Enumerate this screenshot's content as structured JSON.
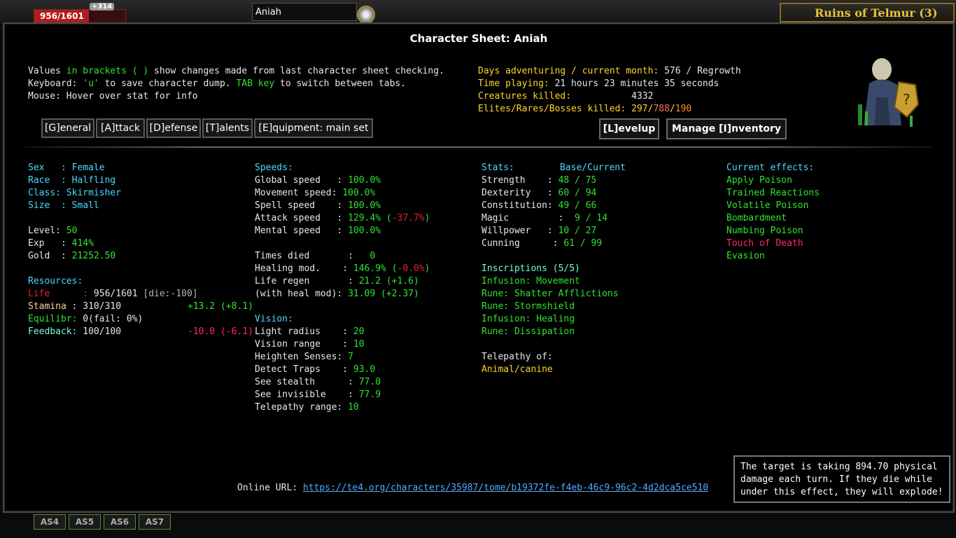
{
  "hud": {
    "life": "956/1601",
    "life_fraction": 0.597,
    "regen": "+314",
    "player_name": "Aniah",
    "zone": "Ruins of Telmur (3)",
    "hotkeys": [
      "AS4",
      "AS5",
      "AS6",
      "AS7"
    ]
  },
  "sheet": {
    "title": "Character Sheet: Aniah",
    "help": {
      "l1_a": "Values ",
      "l1_b": "in brackets ( )",
      "l1_c": " show changes made from last character sheet checking.",
      "l2_a": "Keyboard: ",
      "l2_b": "'u'",
      "l2_c": " to save character dump. ",
      "l2_d": "TAB key",
      "l2_e": " to switch between tabs.",
      "l3": "Mouse: Hover over stat for info"
    },
    "summary": {
      "days_label": "Days adventuring / current month:",
      "days_value": " 576 / Regrowth",
      "time_label": "Time playing:",
      "time_value": " 21 hours 23 minutes 35 seconds",
      "kills_label": "Creatures killed:",
      "kills_value": "           4332",
      "elite_label": "Elites/Rares/Bosses killed:",
      "elite_a": " 297/",
      "elite_b": "788",
      "elite_c": "/",
      "elite_d": "190"
    },
    "tabs": [
      "[G]eneral",
      "[A]ttack",
      "[D]efense",
      "[T]alents",
      "[E]quipment: main set"
    ],
    "levelup": "[L]evelup",
    "inventory": "Manage [I]nventory",
    "general": {
      "sex_label": "Sex   : ",
      "sex": "Female",
      "race_label": "Race  : ",
      "race": "Halfling",
      "class_label": "Class: ",
      "class": "Skirmisher",
      "size_label": "Size  : ",
      "size": "Small",
      "level_label": "Level: ",
      "level": "50",
      "exp_label": "Exp   : ",
      "exp": "414%",
      "gold_label": "Gold  : ",
      "gold": "21252.50"
    },
    "resources": {
      "title": "Resources:",
      "life_label": "Life      : ",
      "life": "956/1601",
      "life_die": " [die:-100]",
      "stamina_label": "Stamina",
      "stamina": " : 310/310",
      "stamina_regen": "+13.2 (+8.1)",
      "equi_label": "Equilibr: ",
      "equi": "0(fail: 0%)",
      "feedback_label": "Feedback: ",
      "feedback": "100/100",
      "feedback_regen": "-10.0 (-6.1)"
    },
    "speeds": {
      "title": "Speeds:",
      "global_label": "Global speed   : ",
      "global": "100.0%",
      "movement_label": "Movement speed: ",
      "movement": "100.0%",
      "spell_label": "Spell speed    : ",
      "spell": "100.0%",
      "attack_label": "Attack speed   : ",
      "attack": "129.4% (",
      "attack_delta": "-37.7%",
      "attack_close": ")",
      "mental_label": "Mental speed   : ",
      "mental": "100.0%",
      "died_label": "Times died       :   ",
      "died": "0",
      "heal_label": "Healing mod.    : ",
      "heal": "146.9% (",
      "heal_delta": "-0.0%",
      "heal_close": ")",
      "regen_label": "Life regen       : ",
      "regen": "21.2 (+1.6)",
      "withheal_label": "(with heal mod): ",
      "withheal": "31.09 (+2.37)"
    },
    "vision": {
      "title": "Vision:",
      "light_label": "Light radius    : ",
      "light": "20",
      "range_label": "Vision range    : ",
      "range": "10",
      "heighten_label": "Heighten Senses: ",
      "heighten": "7",
      "traps_label": "Detect Traps    : ",
      "traps": "93.0",
      "stealth_label": "See stealth      : ",
      "stealth": "77.0",
      "invis_label": "See invisible    : ",
      "invis": "77.9",
      "tele_label": "Telepathy range: ",
      "tele": "10"
    },
    "stats": {
      "title": "Stats:",
      "header": "Base/Current",
      "rows": [
        {
          "label": "Strength    : ",
          "value": "48 / 75"
        },
        {
          "label": "Dexterity   : ",
          "value": "60 / 94"
        },
        {
          "label": "Constitution: ",
          "value": "49 / 66"
        },
        {
          "label": "Magic         : ",
          "value": " 9 / 14"
        },
        {
          "label": "Willpower   : ",
          "value": "10 / 27"
        },
        {
          "label": "Cunning      : ",
          "value": "61 / 99"
        }
      ]
    },
    "inscriptions": {
      "title": "Inscriptions (5/5)",
      "items": [
        "Infusion: Movement",
        "Rune: Shatter Afflictions",
        "Rune: Stormshield",
        "Infusion: Healing",
        "Rune: Dissipation"
      ]
    },
    "telepathy": {
      "title": "Telepathy of:",
      "value": "Animal/canine"
    },
    "effects": {
      "title": "Current effects:",
      "items": [
        {
          "label": "Apply Poison",
          "color": "#31e331"
        },
        {
          "label": "Trained Reactions",
          "color": "#31e331"
        },
        {
          "label": "Volatile Poison",
          "color": "#31e331"
        },
        {
          "label": "Bombardment",
          "color": "#31e331"
        },
        {
          "label": "Numbing Poison",
          "color": "#31e331"
        },
        {
          "label": "Touch of Death",
          "color": "#ff2a6a"
        },
        {
          "label": "Evasion",
          "color": "#31e331"
        }
      ]
    },
    "online_label": "Online URL: ",
    "online_url": "https://te4.org/characters/35987/tome/b19372fe-f4eb-46c9-96c2-4d2dca5ce510",
    "tooltip": "The target is taking 894.70 physical\ndamage each turn. If they die while\nunder this effect, they will explode!"
  }
}
